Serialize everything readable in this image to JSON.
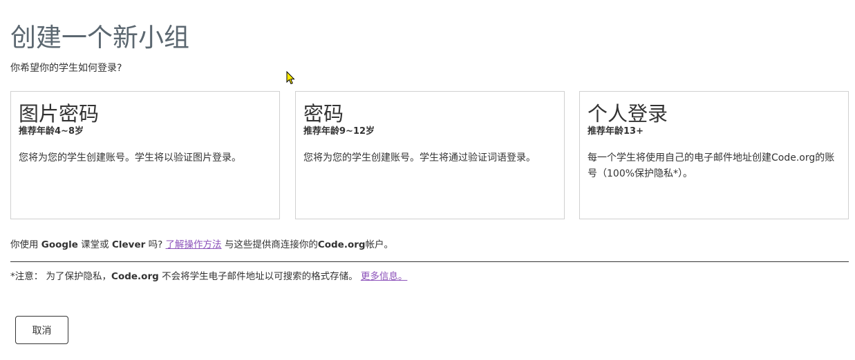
{
  "page": {
    "title": "创建一个新小组",
    "subtitle": "你希望你的学生如何登录?"
  },
  "cards": [
    {
      "title": "图片密码",
      "age_prefix": "推荐年龄",
      "age_value": "4~8",
      "age_suffix": "岁",
      "description": "您将为您的学生创建账号。学生将以验证图片登录。"
    },
    {
      "title": "密码",
      "age_prefix": "推荐年龄",
      "age_value": "9~12",
      "age_suffix": "岁",
      "description": "您将为您的学生创建账号。学生将通过验证词语登录。"
    },
    {
      "title": "个人登录",
      "age_prefix": "推荐年龄",
      "age_value": "13+",
      "age_suffix": "",
      "description": "每一个学生将使用自己的电子邮件地址创建Code.org的账号（100%保护隐私*）。"
    }
  ],
  "provider": {
    "text_1": "你使用 ",
    "google": "Google",
    "text_2": " 课堂或 ",
    "clever": "Clever",
    "text_3": " 吗?  ",
    "link": "了解操作方法",
    "text_4": " 与这些提供商连接你的",
    "codeorg": "Code.org",
    "text_5": "帐户。"
  },
  "note": {
    "text_1": "*注意：  为了保护隐私，",
    "codeorg": "Code.org",
    "text_2": " 不会将学生电子邮件地址以可搜索的格式存储。 ",
    "link": "更多信息。"
  },
  "buttons": {
    "cancel": "取消"
  },
  "colors": {
    "link": "#8c52ba",
    "title": "#5b6770",
    "border": "#d0d0d0",
    "text": "#333333"
  }
}
